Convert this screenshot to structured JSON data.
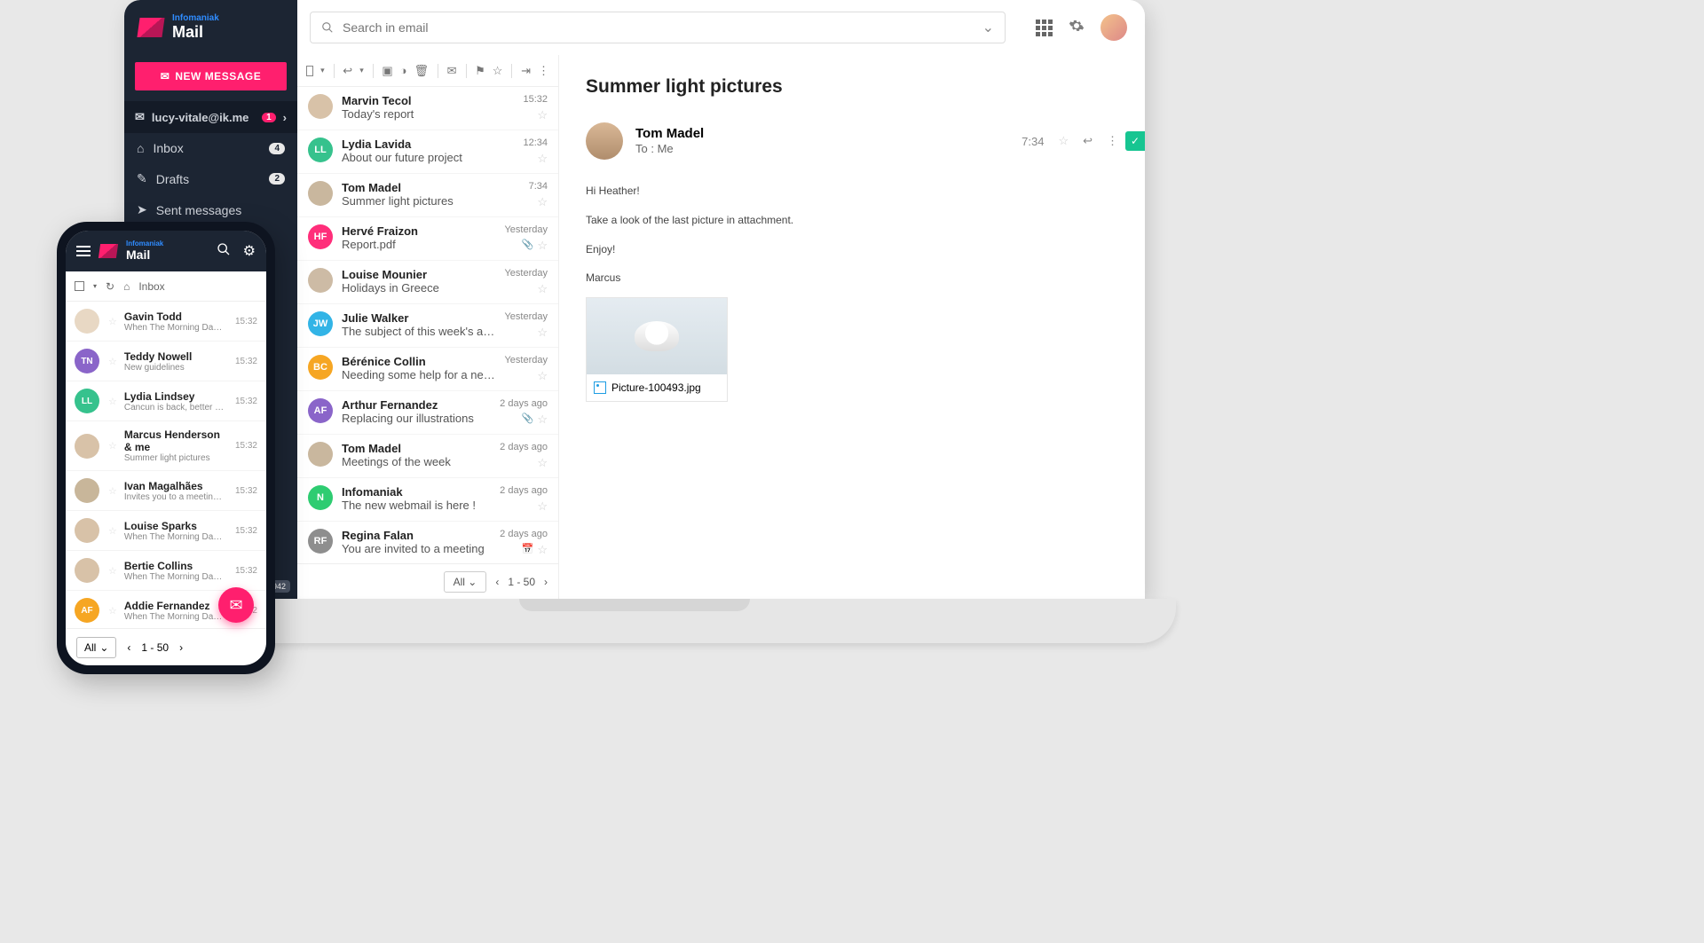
{
  "brand": {
    "company": "Infomaniak",
    "product": "Mail"
  },
  "search": {
    "placeholder": "Search in email"
  },
  "newMessage": "NEW MESSAGE",
  "account": {
    "email": "lucy-vitale@ik.me",
    "badge": "1"
  },
  "sidebar": {
    "items": [
      {
        "label": "Inbox",
        "count": "4"
      },
      {
        "label": "Drafts",
        "count": "2"
      },
      {
        "label": "Sent messages"
      }
    ],
    "footerBadge": "1942"
  },
  "avatarColors": {
    "LL": "#36c28d",
    "TM": "#c9b79e",
    "HF": "#ff2e7a",
    "LM": "#cdbba5",
    "JW": "#32b4e6",
    "BC": "#f6a623",
    "AF": "#8a65c9",
    "N": "#2ecc71",
    "RF": "#8e8e8e",
    "TN": "#8a65c9",
    "MH": "#d8c2a8",
    "IM": "#c8b69a",
    "LS": "#d8c2a8",
    "BCo": "#d8c2a8"
  },
  "messages": [
    {
      "from": "Marvin Tecol",
      "subject": "Today's report",
      "time": "15:32",
      "av": "",
      "color": "#d8c2a8"
    },
    {
      "from": "Lydia Lavida",
      "subject": "About our future project",
      "time": "12:34",
      "av": "LL",
      "color": "#36c28d"
    },
    {
      "from": "Tom Madel",
      "subject": "Summer light pictures",
      "time": "7:34",
      "av": "",
      "color": "#c9b79e"
    },
    {
      "from": "Hervé Fraizon",
      "subject": "Report.pdf",
      "time": "Yesterday",
      "av": "HF",
      "color": "#ff2e7a",
      "clip": true
    },
    {
      "from": "Louise Mounier",
      "subject": "Holidays in Greece",
      "time": "Yesterday",
      "av": "",
      "color": "#cdbba5"
    },
    {
      "from": "Julie Walker",
      "subject": "The subject of this week's article",
      "time": "Yesterday",
      "av": "JW",
      "color": "#32b4e6"
    },
    {
      "from": "Bérénice Collin",
      "subject": "Needing some help for a newsletter",
      "time": "Yesterday",
      "av": "BC",
      "color": "#f6a623"
    },
    {
      "from": "Arthur Fernandez",
      "subject": "Replacing our illustrations",
      "time": "2 days ago",
      "av": "AF",
      "color": "#8a65c9",
      "clip": true
    },
    {
      "from": "Tom Madel",
      "subject": "Meetings of the week",
      "time": "2 days ago",
      "av": "",
      "color": "#c9b79e"
    },
    {
      "from": "Infomaniak",
      "subject": "The new webmail is here !",
      "time": "2 days ago",
      "av": "N",
      "color": "#2ecc71"
    },
    {
      "from": "Regina Falan",
      "subject": "You are invited to a meeting",
      "time": "2 days ago",
      "av": "RF",
      "color": "#8e8e8e",
      "cal": true
    }
  ],
  "listFooter": {
    "all": "All",
    "range": "1 - 50"
  },
  "reader": {
    "subject": "Summer light pictures",
    "senderName": "Tom Madel",
    "to": "To : Me",
    "time": "7:34",
    "body": [
      "Hi Heather!",
      "Take a look of the last picture in attachment.",
      "Enjoy!",
      "Marcus"
    ],
    "attachment": "Picture-100493.jpg"
  },
  "phone": {
    "inboxLabel": "Inbox",
    "messages": [
      {
        "from": "Gavin Todd",
        "subject": "When The Morning Dawns",
        "time": "15:32",
        "av": "",
        "color": "#e8d8c4"
      },
      {
        "from": "Teddy Nowell",
        "subject": "New guidelines",
        "time": "15:32",
        "av": "TN",
        "color": "#8a65c9"
      },
      {
        "from": "Lydia Lindsey",
        "subject": "Cancun is back, better …",
        "time": "15:32",
        "av": "LL",
        "color": "#36c28d"
      },
      {
        "from": "Marcus Henderson & me",
        "subject": "Summer light pictures",
        "time": "15:32",
        "av": "",
        "color": "#d8c2a8"
      },
      {
        "from": "Ivan Magalhães",
        "subject": "Invites you to a meeting event",
        "time": "15:32",
        "av": "",
        "color": "#c8b69a"
      },
      {
        "from": "Louise Sparks",
        "subject": "When The Morning Dawns",
        "time": "15:32",
        "av": "",
        "color": "#d8c2a8"
      },
      {
        "from": "Bertie Collins",
        "subject": "When The Morning Dawns",
        "time": "15:32",
        "av": "",
        "color": "#d8c2a8"
      },
      {
        "from": "Addie Fernandez",
        "subject": "When The Morning Dawns",
        "time": "15:32",
        "av": "AF",
        "color": "#f6a623"
      }
    ],
    "footer": {
      "all": "All",
      "range": "1 - 50"
    }
  }
}
